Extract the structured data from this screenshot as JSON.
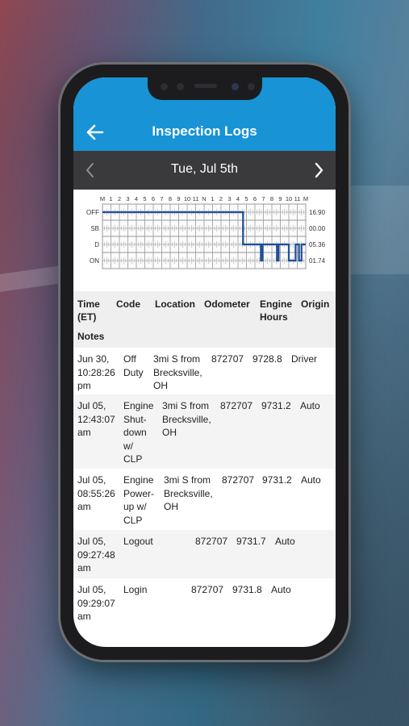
{
  "header": {
    "title": "Inspection Logs",
    "back_icon": "arrow-left-icon"
  },
  "date_nav": {
    "label": "Tue, Jul 5th",
    "prev_icon": "chevron-left-icon",
    "next_icon": "chevron-right-icon"
  },
  "colors": {
    "accent": "#1793d6",
    "date_bar": "#3a3a3c",
    "graph_line": "#1f4e9a"
  },
  "chart_data": {
    "type": "line",
    "hours": [
      "M",
      "1",
      "2",
      "3",
      "4",
      "5",
      "6",
      "7",
      "8",
      "9",
      "10",
      "11",
      "N",
      "1",
      "2",
      "3",
      "4",
      "5",
      "6",
      "7",
      "8",
      "9",
      "10",
      "11",
      "M"
    ],
    "statuses": [
      "OFF",
      "SB",
      "D",
      "ON"
    ],
    "totals": [
      "16.90",
      "00.00",
      "05.36",
      "01.74"
    ],
    "segments": [
      {
        "status": "OFF",
        "start": 0,
        "end": 16.6
      },
      {
        "status": "D",
        "start": 16.6,
        "end": 18.7
      },
      {
        "status": "ON",
        "start": 18.7,
        "end": 18.9
      },
      {
        "status": "D",
        "start": 18.9,
        "end": 20.6
      },
      {
        "status": "ON",
        "start": 20.6,
        "end": 20.8
      },
      {
        "status": "D",
        "start": 20.8,
        "end": 22.0
      },
      {
        "status": "ON",
        "start": 22.0,
        "end": 22.8
      },
      {
        "status": "D",
        "start": 22.8,
        "end": 23.2
      },
      {
        "status": "ON",
        "start": 23.2,
        "end": 23.5
      },
      {
        "status": "D",
        "start": 23.5,
        "end": 24
      }
    ]
  },
  "table": {
    "headers": {
      "time": [
        "Time",
        "(ET)"
      ],
      "code": "Code",
      "location": "Location",
      "odometer": "Odometer",
      "engine_hours": [
        "Engine",
        "Hours"
      ],
      "origin": "Origin",
      "notes": "Notes"
    },
    "rows": [
      {
        "time": [
          "Jun 30,",
          "10:28:26",
          "pm"
        ],
        "code": [
          "Off",
          "Duty"
        ],
        "location": [
          "3mi S from",
          "Brecksville,",
          "OH"
        ],
        "odometer": "872707",
        "engine_hours": "9728.8",
        "origin": "Driver"
      },
      {
        "time": [
          "Jul 05,",
          "12:43:07",
          "am"
        ],
        "code": [
          "Engine",
          "Shut-",
          "down",
          "w/",
          "CLP"
        ],
        "location": [
          "3mi S from",
          "Brecksville,",
          "OH"
        ],
        "odometer": "872707",
        "engine_hours": "9731.2",
        "origin": "Auto"
      },
      {
        "time": [
          "Jul 05,",
          "08:55:26",
          "am"
        ],
        "code": [
          "Engine",
          "Power-",
          "up w/",
          "CLP"
        ],
        "location": [
          "3mi S from",
          "Brecksville,",
          "OH"
        ],
        "odometer": "872707",
        "engine_hours": "9731.2",
        "origin": "Auto"
      },
      {
        "time": [
          "Jul 05,",
          "09:27:48",
          "am"
        ],
        "code": [
          "Logout"
        ],
        "location": [],
        "odometer": "872707",
        "engine_hours": "9731.7",
        "origin": "Auto"
      },
      {
        "time": [
          "Jul 05,",
          "09:29:07",
          "am"
        ],
        "code": [
          "Login"
        ],
        "location": [],
        "odometer": "872707",
        "engine_hours": "9731.8",
        "origin": "Auto"
      }
    ]
  }
}
